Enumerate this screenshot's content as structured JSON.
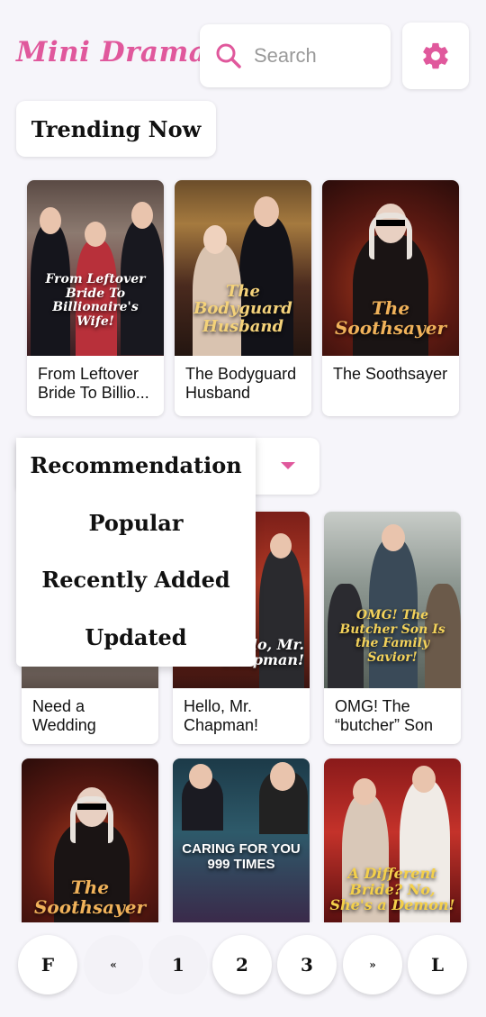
{
  "header": {
    "logo": "Mini Drama",
    "search_placeholder": "Search"
  },
  "trending": {
    "title": "Trending Now",
    "items": [
      {
        "caption": "From Leftover Bride To Billio...",
        "poster_title": "From Leftover Bride To Billionaire's Wife!"
      },
      {
        "caption": "The Bodyguard Husband",
        "poster_title": "The Bodyguard Husband"
      },
      {
        "caption": "The Soothsayer",
        "poster_title": "The Soothsayer"
      }
    ]
  },
  "sort": {
    "options": [
      "Recommendation",
      "Popular",
      "Recently Added",
      "Updated"
    ]
  },
  "grid": {
    "row1": [
      {
        "caption": "Need a Wedding Cras...",
        "poster_title": ""
      },
      {
        "caption": "Hello, Mr. Chapman!",
        "poster_title": "Hello, Mr. Chapman!"
      },
      {
        "caption": "OMG! The “butcher” Son ...",
        "poster_title": "OMG! The Butcher Son Is the Family Savior!"
      }
    ],
    "row2": [
      {
        "poster_title": "The Soothsayer"
      },
      {
        "poster_title": "CARING FOR YOU 999 TIMES"
      },
      {
        "poster_title": "A Different Bride? No, She's a Demon!"
      }
    ]
  },
  "pagination": {
    "buttons": [
      "F",
      "«",
      "1",
      "2",
      "3",
      "»",
      "L"
    ]
  },
  "colors": {
    "accent": "#e0589c",
    "background": "#f6f5fa"
  },
  "icons": {
    "search": "search-icon",
    "settings": "gear-icon",
    "dropdown": "caret-down-icon"
  }
}
